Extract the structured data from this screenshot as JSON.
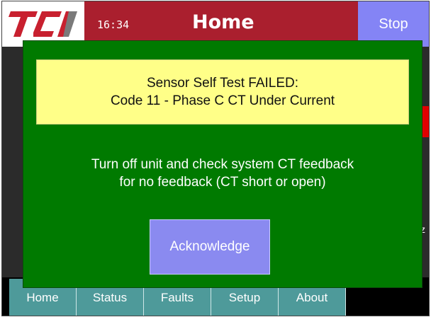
{
  "header": {
    "logo_text": "TCI",
    "time": "16:34",
    "title": "Home",
    "stop_label": "Stop"
  },
  "dialog": {
    "alert_line1": "Sensor Self Test FAILED:",
    "alert_line2": "Code 11 - Phase C CT Under Current",
    "message_line1": "Turn off unit and check system CT feedback",
    "message_line2": "for no feedback (CT short or open)",
    "acknowledge_label": "Acknowledge"
  },
  "background": {
    "partial_glyph": "z"
  },
  "nav": {
    "items": [
      "Home",
      "Status",
      "Faults",
      "Setup",
      "About"
    ]
  },
  "colors": {
    "header_red": "#aa1f2e",
    "stop_blue": "#8484f5",
    "dialog_green": "#007a00",
    "alert_yellow": "#ffff88",
    "nav_teal": "#4e9a9a"
  }
}
